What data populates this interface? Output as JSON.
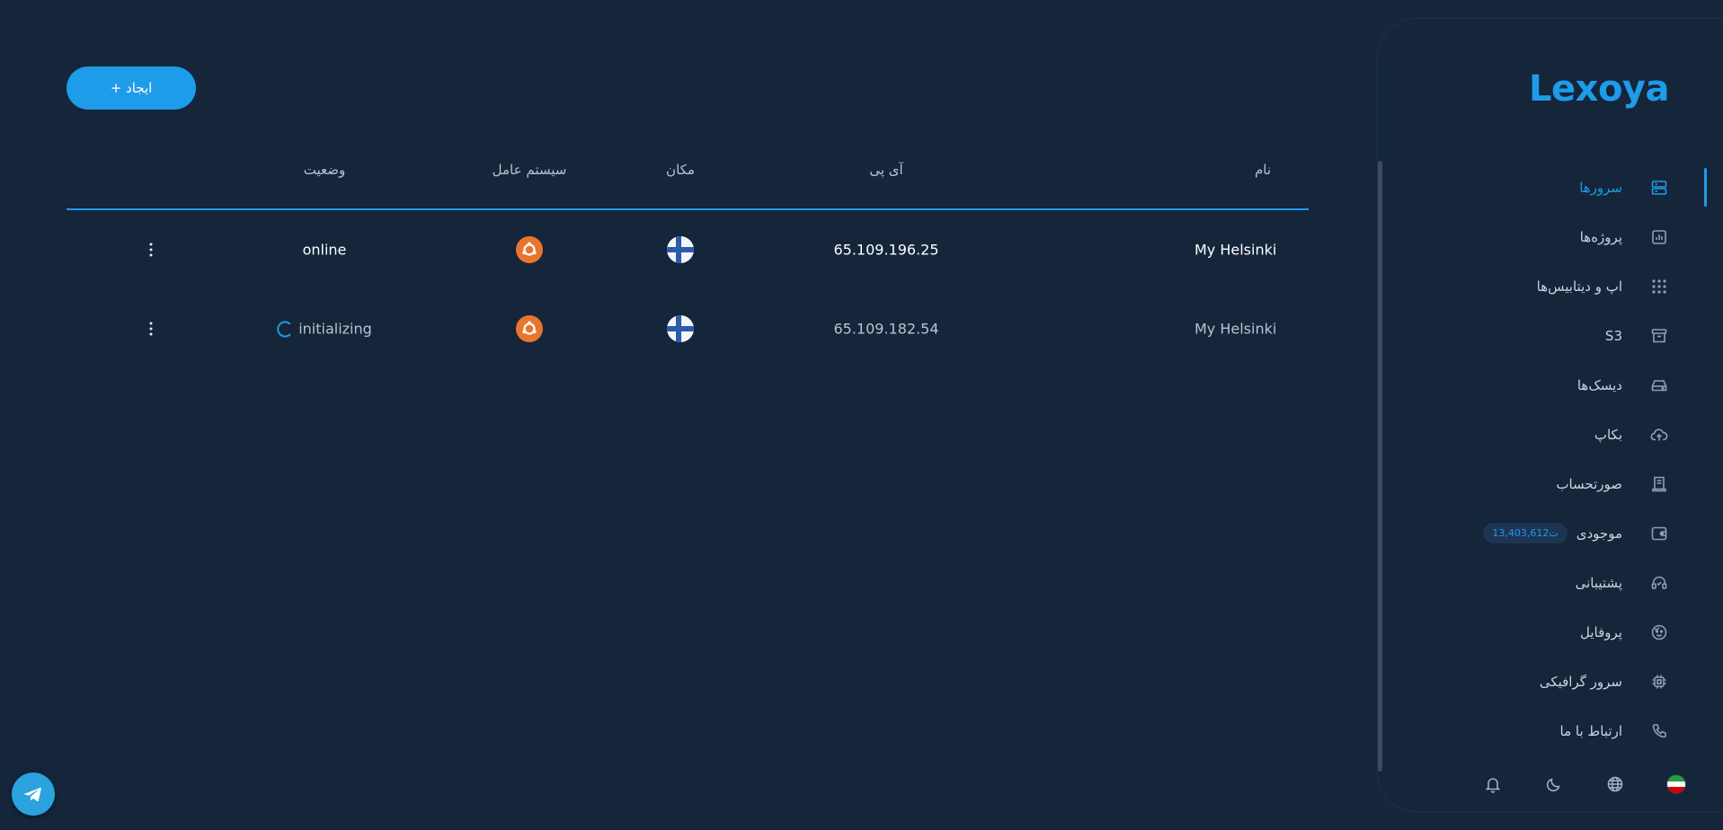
{
  "brand": "Lexoya",
  "create_button": {
    "label": "+ ایجاد"
  },
  "table": {
    "headers": {
      "name": "نام",
      "ip": "آی پی",
      "location": "مکان",
      "os": "سیستم عامل",
      "status": "وضعیت"
    },
    "rows": [
      {
        "name": "My Helsinki",
        "ip": "65.109.196.25",
        "location_icon": "finland-flag-icon",
        "os_icon": "ubuntu-icon",
        "status": "online"
      },
      {
        "name": "My Helsinki",
        "ip": "65.109.182.54",
        "location_icon": "finland-flag-icon",
        "os_icon": "ubuntu-icon",
        "status": "initializing"
      }
    ]
  },
  "sidebar": {
    "items": [
      {
        "label": "سرورها",
        "icon": "server-icon",
        "active": true
      },
      {
        "label": "پروژه‌ها",
        "icon": "chart-icon"
      },
      {
        "label": "اپ و دیتابیس‌ها",
        "icon": "grid-icon"
      },
      {
        "label": "S3",
        "icon": "archive-icon"
      },
      {
        "label": "دیسک‌ها",
        "icon": "disk-icon"
      },
      {
        "label": "بکاپ",
        "icon": "cloud-upload-icon"
      },
      {
        "label": "صورتحساب",
        "icon": "receipt-icon"
      },
      {
        "label": "موجودی",
        "icon": "wallet-icon",
        "badge": "13,403,612ت"
      },
      {
        "label": "پشتیبانی",
        "icon": "headset-icon"
      },
      {
        "label": "پروفایل",
        "icon": "face-icon"
      },
      {
        "label": "سرور گرافیکی",
        "icon": "chip-icon"
      },
      {
        "label": "ارتباط با ما",
        "icon": "phone-icon"
      }
    ],
    "footer_icons": [
      "bell-icon",
      "moon-icon",
      "globe-icon",
      "iran-flag-icon"
    ]
  },
  "colors": {
    "background": "#15253a",
    "accent": "#1e9be9",
    "ubuntu": "#e9752d"
  }
}
